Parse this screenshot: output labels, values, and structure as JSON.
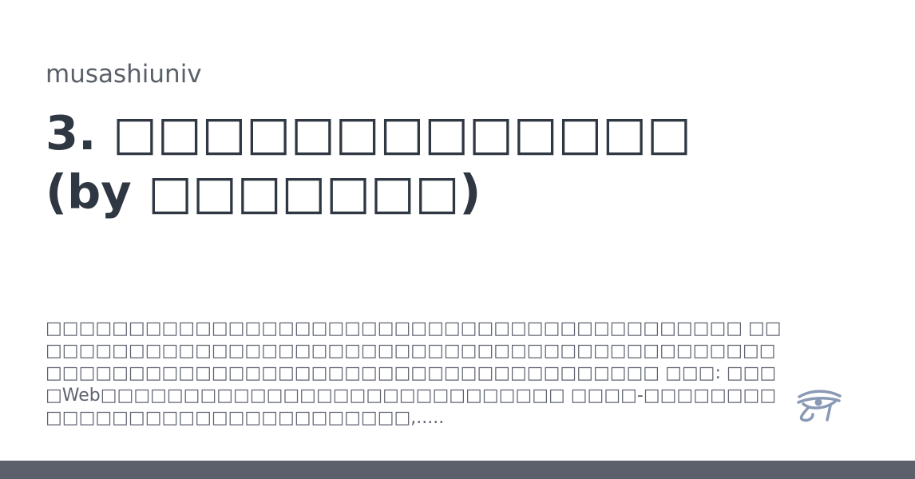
{
  "site": {
    "name": "musashiuniv"
  },
  "article": {
    "title": "3. □□□□□□□□□□□□□ (by □□□□□□□)",
    "description": "□□□□□□□□□□□□□□□□□□□□□□□□□□□□□□□□□□□□□□□□□□ □□□□□□□□□□□□□□□□□□□□□□□□□□□□□□□□□□□□□□□□□□□□□□□□□□□□□□□□□□□□□□□□□□□□□□□□□□□□□□□□□□□ □□□: □□□□Web□□□□□□□□□□□□□□□□□□□□□□□□□□□□ □□□□-□□□□□□□□□□□□□□□□□□□□□□□□□□□□□□,....."
  },
  "logo": {
    "icon": "eye-of-horus-icon",
    "color": "#8a9ab5"
  },
  "theme": {
    "title_color": "#2f3742",
    "muted_text_color": "#5a5f68",
    "bar_color": "#5b606b"
  }
}
